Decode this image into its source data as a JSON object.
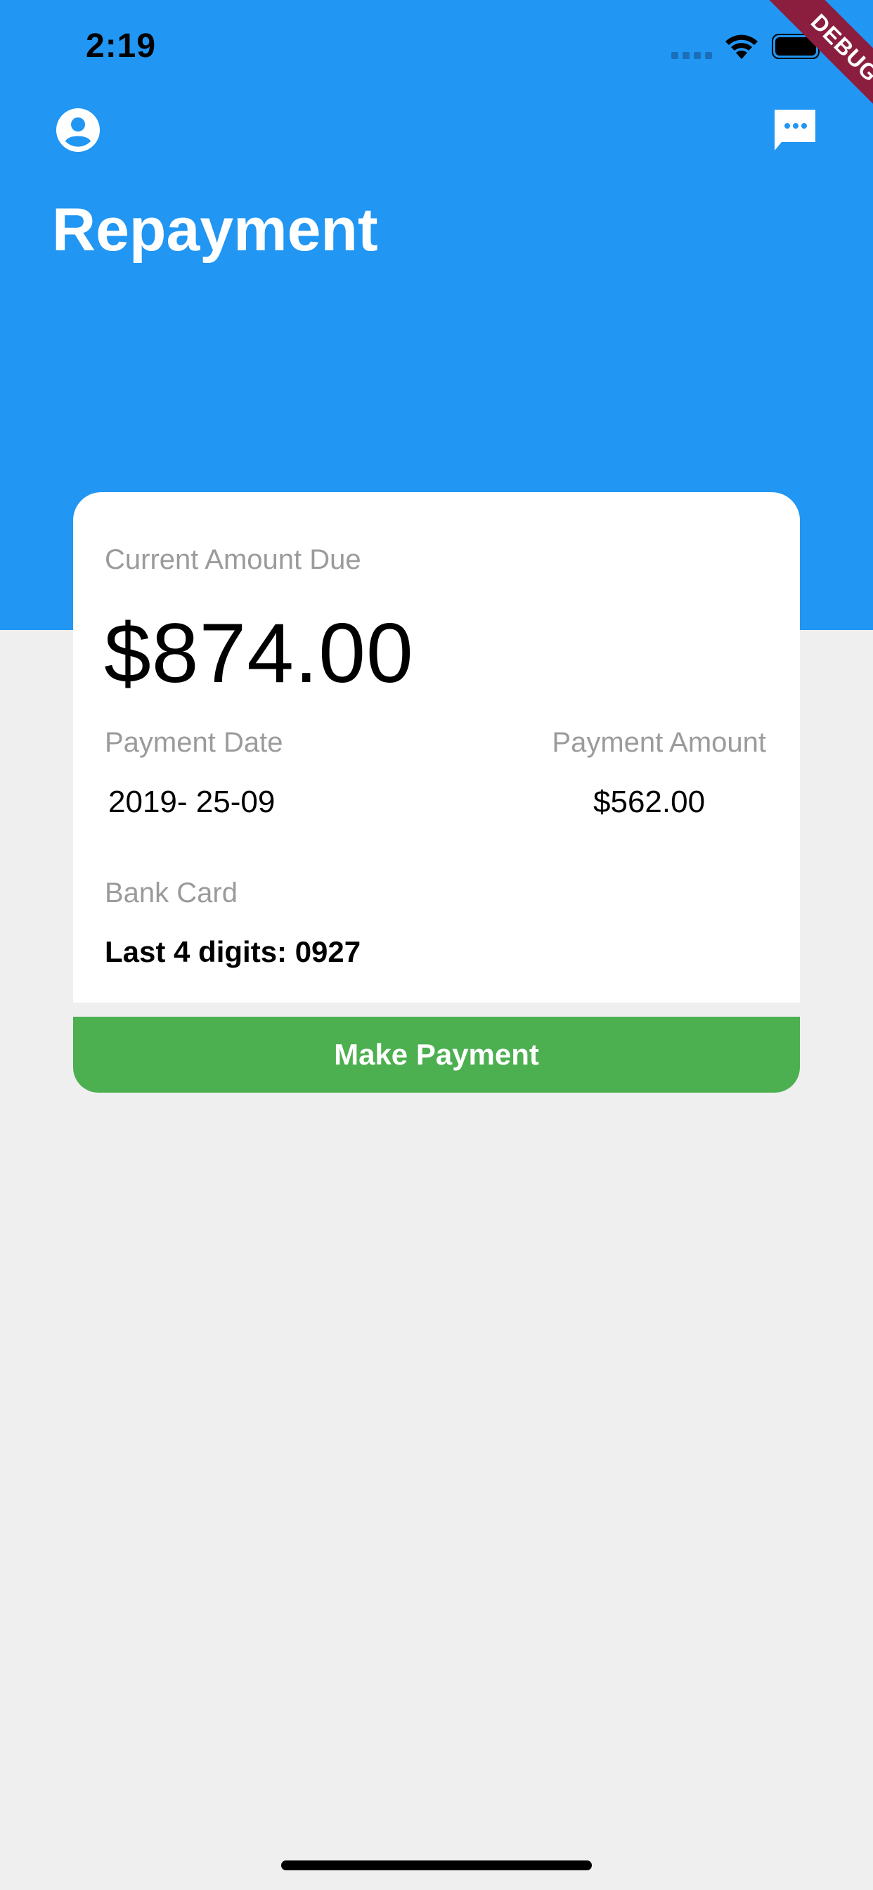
{
  "status_bar": {
    "time": "2:19"
  },
  "debug_banner": "DEBUG",
  "header": {
    "title": "Repayment",
    "left_icon": "account-circle-icon",
    "right_icon": "chat-bubble-icon",
    "background_color": "#2196f3"
  },
  "card": {
    "current_due_label": "Current Amount Due",
    "current_due_amount": "$874.00",
    "payment_date_label": "Payment Date",
    "payment_date_value": "2019- 25-09",
    "payment_amount_label": "Payment Amount",
    "payment_amount_value": "$562.00",
    "bank_card_label": "Bank Card",
    "bank_card_value": "Last 4 digits: 0927"
  },
  "actions": {
    "make_payment_label": "Make Payment",
    "button_color": "#4caf50"
  }
}
